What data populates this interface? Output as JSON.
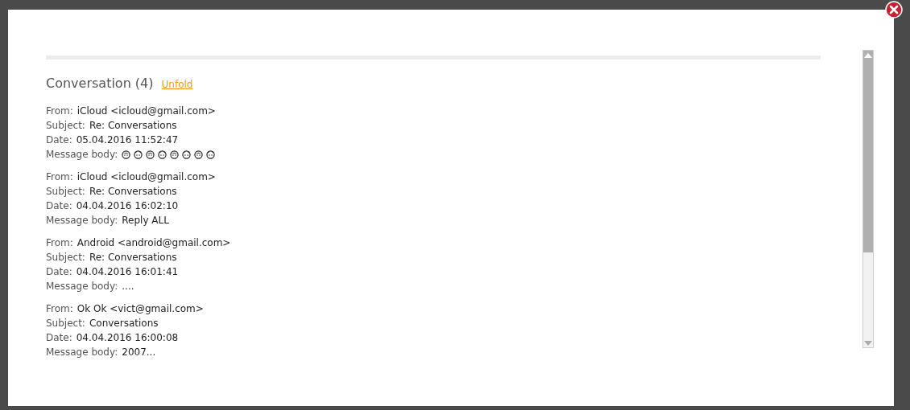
{
  "conversation": {
    "title": "Conversation (4)",
    "unfold_link": "Unfold"
  },
  "messages": [
    {
      "kind": "icons",
      "from_label": "From:",
      "from": "iCloud <icloud@gmail.com>",
      "subject_label": "Subject:",
      "subject": "Re: Conversations",
      "date_label": "Date:",
      "date": "05.04.2016 11:52:47",
      "body_label": "Message body:"
    },
    {
      "kind": "text",
      "from_label": "From:",
      "from": "iCloud <icloud@gmail.com>",
      "subject_label": "Subject:",
      "subject": "Re: Conversations",
      "date_label": "Date:",
      "date": "04.04.2016 16:02:10",
      "body_label": "Message body:",
      "body": "Reply ALL"
    },
    {
      "kind": "text",
      "from_label": "From:",
      "from": "Android <android@gmail.com>",
      "subject_label": "Subject:",
      "subject": "Re: Conversations",
      "date_label": "Date:",
      "date": "04.04.2016 16:01:41",
      "body_label": "Message body:",
      "body": "...."
    },
    {
      "kind": "text",
      "from_label": "From:",
      "from": "Ok Ok <vict@gmail.com>",
      "subject_label": "Subject:",
      "subject": "Conversations",
      "date_label": "Date:",
      "date": "04.04.2016 16:00:08",
      "body_label": "Message body:",
      "body": "2007..."
    }
  ]
}
